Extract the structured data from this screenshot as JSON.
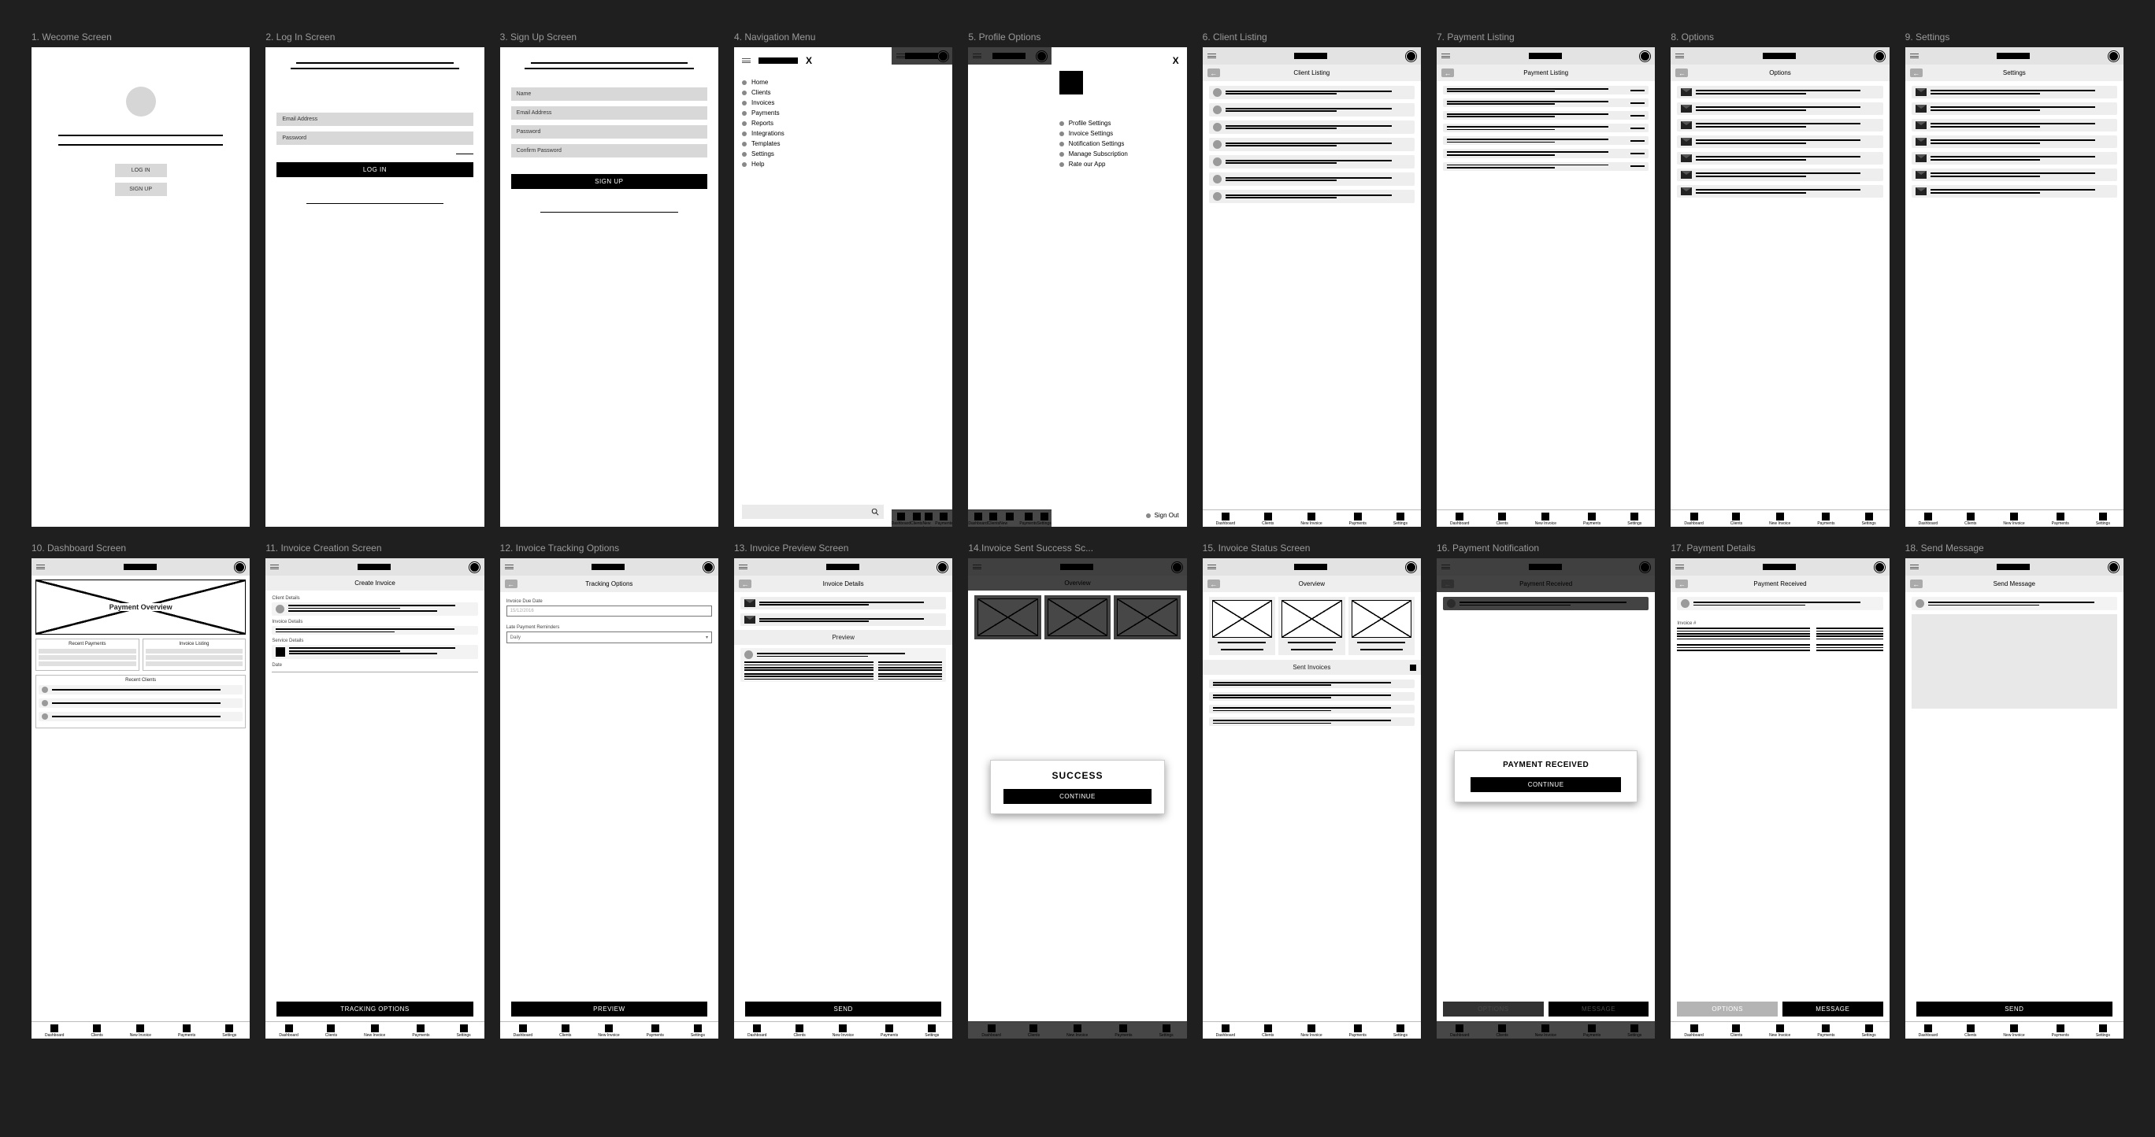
{
  "screens": {
    "s1": "1. Wecome Screen",
    "s2": "2. Log In Screen",
    "s3": "3. Sign Up Screen",
    "s4": "4. Navigation Menu",
    "s5": "5. Profile Options",
    "s6": "6. Client Listing",
    "s7": "7. Payment Listing",
    "s8": "8. Options",
    "s9": "9. Settings",
    "s10": "10. Dashboard Screen",
    "s11": "11. Invoice Creation Screen",
    "s12": "12. Invoice Tracking Options",
    "s13": "13. Invoice Preview Screen",
    "s14": "14.Invoice Sent Success Sc...",
    "s15": "15. Invoice Status Screen",
    "s16": "16. Payment Notification",
    "s17": "17. Payment Details",
    "s18": "18. Send Message"
  },
  "welcome": {
    "login": "LOG IN",
    "signup": "SIGN UP"
  },
  "login": {
    "email": "Email Address",
    "password": "Password",
    "submit": "LOG IN"
  },
  "signup": {
    "name": "Name",
    "email": "Email Address",
    "password": "Password",
    "confirm": "Confirm Password",
    "submit": "SIGN UP"
  },
  "nav": {
    "items": [
      "Home",
      "Clients",
      "Invoices",
      "Payments",
      "Reports",
      "Integrations",
      "Templates",
      "Settings",
      "Help"
    ]
  },
  "profile": {
    "items": [
      "Profile Settings",
      "Invoice Settings",
      "Notification Settings",
      "Manage Subscription",
      "Rate our App"
    ],
    "signout": "Sign Out"
  },
  "headers": {
    "client": "Client Listing",
    "payment": "Payment Listing",
    "options": "Options",
    "settings": "Settings",
    "createInv": "Create Invoice",
    "tracking": "Tracking Options",
    "invDetails": "Invoice Details",
    "overview": "Overview",
    "payRecv": "Payment Received",
    "sendMsg": "Send Message",
    "payRecvHdr": "Payment Received"
  },
  "dashboard": {
    "chartTitle": "Payment Overview",
    "recentPay": "Recent Payments",
    "invList": "Invoice Listing",
    "recentClients": "Recent Clients"
  },
  "inv": {
    "clientDetails": "Client Details",
    "invoiceDetails": "Invoice Details",
    "serviceDetails": "Service Details",
    "date": "Date",
    "due": "Invoice Due Date",
    "duePh": "15/12/2016",
    "reminders": "Late Payment Reminders",
    "remSel": "Daily",
    "preview": "Preview",
    "invoiceNo": "Invoice #",
    "sentInv": "Sent Invoices"
  },
  "btns": {
    "tracking": "TRACKING OPTIONS",
    "preview": "PREVIEW",
    "send": "SEND",
    "continue": "CONTINUE",
    "options": "OPTIONS",
    "message": "MESSAGE"
  },
  "modals": {
    "success": "SUCCESS",
    "payRecv": "PAYMENT RECEIVED"
  },
  "tabs": [
    "Dashboard",
    "Clients",
    "New Invoice",
    "Payments",
    "Settings"
  ]
}
